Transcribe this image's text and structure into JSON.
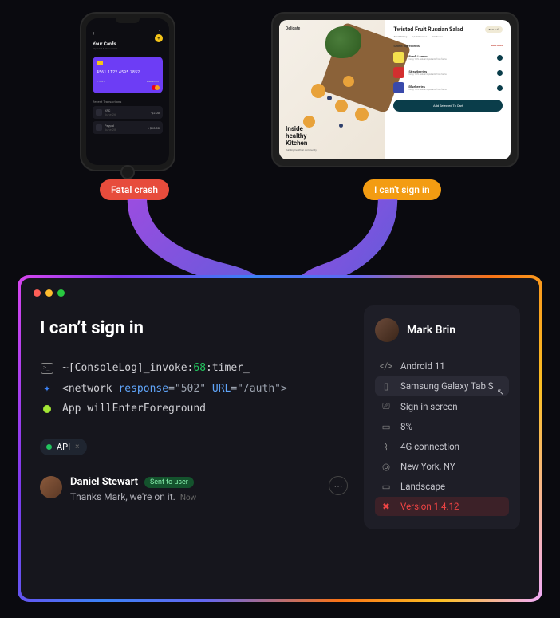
{
  "phone": {
    "title": "Your Cards",
    "subtitle": "Tap Card & Show Cards",
    "card_number": "4561 1122 4595 7852",
    "card_exp": "2· 2021",
    "card_brand": "Mastercard",
    "section": "Recent Transactions",
    "tx": [
      {
        "name": "KFC",
        "date": "June 26",
        "amount": "-$2.00"
      },
      {
        "name": "Paypal",
        "date": "June 28",
        "amount": "+$10.00"
      }
    ]
  },
  "tablet": {
    "brand": "Delicate",
    "hero_l1": "Inside",
    "hero_l2": "healthy",
    "hero_l3": "Kitchen",
    "hero_sub": "Building healthier community",
    "title": "Twisted Fruit Russian Salad",
    "badge": "Back to fi",
    "meta": [
      "★ 4.8 Rating",
      "1,240 Reviews",
      "27 Photos"
    ],
    "section": "Select Ingredients",
    "readmore": "Read More",
    "ingredients": [
      {
        "name": "Fresh Lemon",
        "desc": "Using 100% natural ingredients from farms",
        "color": "#f4e04d"
      },
      {
        "name": "Strawberries",
        "desc": "Using 100% natural ingredients from farms",
        "color": "#d32f2f"
      },
      {
        "name": "Blueberries",
        "desc": "Using 100% natural ingredients from farms",
        "color": "#3949ab"
      }
    ],
    "cta": "Add Selected To Cart"
  },
  "badges": {
    "crash": "Fatal crash",
    "signin": "I can't sign in"
  },
  "issue": {
    "title": "I can’t sign in",
    "logs": {
      "l1_pre": "~[ConsoleLog]_invoke:",
      "l1_num": "68",
      "l1_post": ":timer_",
      "l2_open": "<network ",
      "l2_attr1": "response",
      "l2_val1": "=\"502\" ",
      "l2_attr2": "URL",
      "l2_val2": "=\"/auth\">",
      "l3": "App willEnterForeground"
    },
    "chip": "API",
    "comment": {
      "author": "Daniel Stewart",
      "badge": "Sent to user",
      "text": "Thanks Mark, we're on it.",
      "time": "Now"
    }
  },
  "side": {
    "user": "Mark Brin",
    "rows": [
      {
        "icon": "code",
        "label": "Android 11"
      },
      {
        "icon": "device",
        "label": "Samsung Galaxy Tab S",
        "hover": true
      },
      {
        "icon": "screen",
        "label": "Sign in screen"
      },
      {
        "icon": "battery",
        "label": "8%"
      },
      {
        "icon": "wifi",
        "label": "4G connection"
      },
      {
        "icon": "pin",
        "label": "New York, NY"
      },
      {
        "icon": "orient",
        "label": "Landscape"
      },
      {
        "icon": "tools",
        "label": "Version 1.4.12",
        "warn": true
      }
    ]
  }
}
